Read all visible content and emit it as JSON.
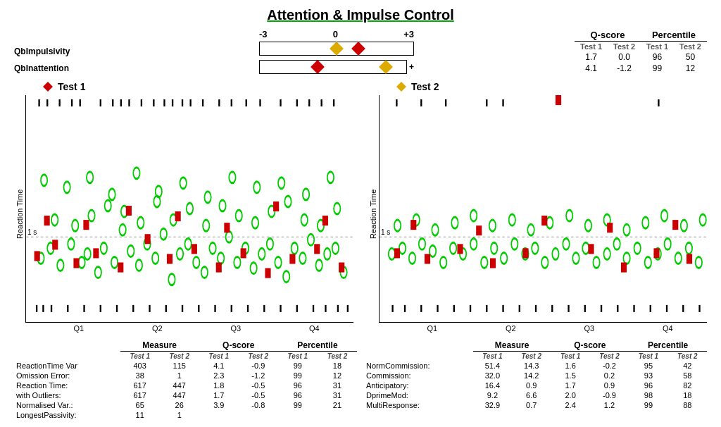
{
  "title": "Attention & Impulse Control",
  "scale": {
    "minus3": "-3",
    "zero": "0",
    "plus3": "+3"
  },
  "qb_labels": {
    "impulsivity": "QbImpulsivity",
    "inattention": "QbInattention"
  },
  "score_table": {
    "q_score_header": "Q-score",
    "percentile_header": "Percentile",
    "test1_header": "Test 1",
    "test2_header": "Test 2",
    "rows": [
      {
        "q1": "1.7",
        "q2": "0.0",
        "p1": "96",
        "p2": "50"
      },
      {
        "q1": "4.1",
        "q2": "-1.2",
        "p1": "99",
        "p2": "12"
      }
    ]
  },
  "chart1": {
    "title": "Test 1",
    "y_label": "Reaction Time",
    "one_s": "1 s",
    "x_labels": [
      "Q1",
      "Q2",
      "Q3",
      "Q4"
    ]
  },
  "chart2": {
    "title": "Test 2",
    "y_label": "Reaction Time",
    "one_s": "1 s",
    "x_labels": [
      "Q1",
      "Q2",
      "Q3",
      "Q4"
    ]
  },
  "table_left": {
    "measure_header": "Measure",
    "qscore_header": "Q-score",
    "percentile_header": "Percentile",
    "test1": "Test 1",
    "test2": "Test 2",
    "rows": [
      {
        "label": "ReactionTime Var",
        "m1": "403",
        "m2": "115",
        "q1": "4.1",
        "q2": "-0.9",
        "p1": "99",
        "p2": "18"
      },
      {
        "label": "Omission Error:",
        "m1": "38",
        "m2": "1",
        "q1": "2.3",
        "q2": "-1.2",
        "p1": "99",
        "p2": "12"
      },
      {
        "label": "Reaction Time:",
        "m1": "617",
        "m2": "447",
        "q1": "1.8",
        "q2": "-0.5",
        "p1": "96",
        "p2": "31"
      },
      {
        "label": "  with Outliers:",
        "m1": "617",
        "m2": "447",
        "q1": "1.7",
        "q2": "-0.5",
        "p1": "96",
        "p2": "31"
      },
      {
        "label": "Normalised Var.:",
        "m1": "65",
        "m2": "26",
        "q1": "3.9",
        "q2": "-0.8",
        "p1": "99",
        "p2": "21"
      },
      {
        "label": "LongestPassivity:",
        "m1": "11",
        "m2": "1",
        "q1": "",
        "q2": "",
        "p1": "",
        "p2": ""
      }
    ]
  },
  "table_right": {
    "measure_header": "Measure",
    "qscore_header": "Q-score",
    "percentile_header": "Percentile",
    "test1": "Test 1",
    "test2": "Test 2",
    "rows": [
      {
        "label": "NormCommission:",
        "m1": "51.4",
        "m2": "14.3",
        "q1": "1.6",
        "q2": "-0.2",
        "p1": "95",
        "p2": "42"
      },
      {
        "label": "Commission:",
        "m1": "32.0",
        "m2": "14.2",
        "q1": "1.5",
        "q2": "0.2",
        "p1": "93",
        "p2": "58"
      },
      {
        "label": "Anticipatory:",
        "m1": "16.4",
        "m2": "0.9",
        "q1": "1.7",
        "q2": "0.9",
        "p1": "96",
        "p2": "82"
      },
      {
        "label": "DprimeMod:",
        "m1": "9.2",
        "m2": "6.6",
        "q1": "2.0",
        "q2": "-0.9",
        "p1": "98",
        "p2": "18"
      },
      {
        "label": "MultiResponse:",
        "m1": "32.9",
        "m2": "0.7",
        "q1": "2.4",
        "q2": "1.2",
        "p1": "99",
        "p2": "88"
      }
    ]
  }
}
